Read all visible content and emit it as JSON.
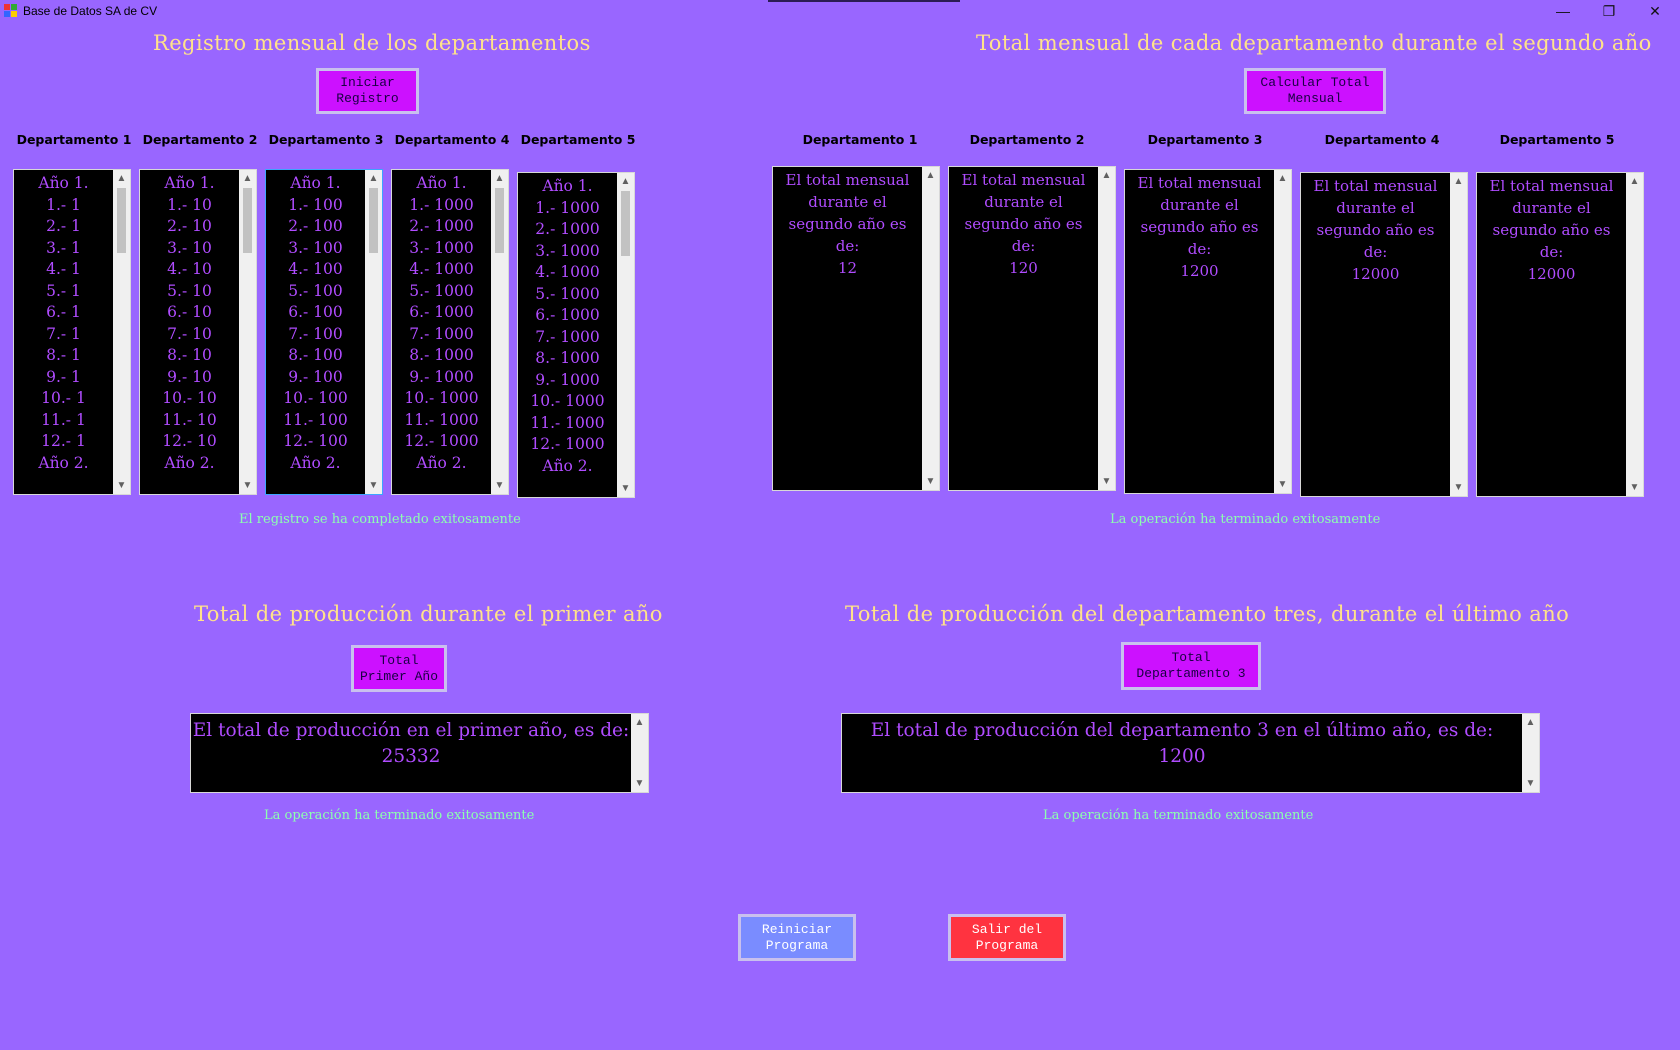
{
  "window": {
    "title": "Base de Datos SA de CV",
    "minimize_glyph": "—",
    "restore_glyph": "❐",
    "close_glyph": "✕"
  },
  "registro": {
    "title": "Registro mensual de los departamentos",
    "button": "Iniciar Registro",
    "columns": [
      "Departamento 1",
      "Departamento 2",
      "Departamento 3",
      "Departamento 4",
      "Departamento 5"
    ],
    "lists": [
      [
        "Año 1.",
        "1.- 1",
        "2.- 1",
        "3.- 1",
        "4.- 1",
        "5.- 1",
        "6.- 1",
        "7.- 1",
        "8.- 1",
        "9.- 1",
        "10.- 1",
        "11.- 1",
        "12.- 1",
        "Año 2."
      ],
      [
        "Año 1.",
        "1.- 10",
        "2.- 10",
        "3.- 10",
        "4.- 10",
        "5.- 10",
        "6.- 10",
        "7.- 10",
        "8.- 10",
        "9.- 10",
        "10.- 10",
        "11.- 10",
        "12.- 10",
        "Año 2."
      ],
      [
        "Año 1.",
        "1.- 100",
        "2.- 100",
        "3.- 100",
        "4.- 100",
        "5.- 100",
        "6.- 100",
        "7.- 100",
        "8.- 100",
        "9.- 100",
        "10.- 100",
        "11.- 100",
        "12.- 100",
        "Año 2."
      ],
      [
        "Año 1.",
        "1.- 1000",
        "2.- 1000",
        "3.- 1000",
        "4.- 1000",
        "5.- 1000",
        "6.- 1000",
        "7.- 1000",
        "8.- 1000",
        "9.- 1000",
        "10.- 1000",
        "11.- 1000",
        "12.- 1000",
        "Año 2."
      ],
      [
        "Año 1.",
        "1.- 1000",
        "2.- 1000",
        "3.- 1000",
        "4.- 1000",
        "5.- 1000",
        "6.- 1000",
        "7.- 1000",
        "8.- 1000",
        "9.- 1000",
        "10.- 1000",
        "11.- 1000",
        "12.- 1000",
        "Año 2."
      ]
    ],
    "status": "El registro se ha completado exitosamente"
  },
  "mensual": {
    "title": "Total mensual de cada departamento durante el segundo año",
    "button": "Calcular Total Mensual",
    "columns": [
      "Departamento 1",
      "Departamento 2",
      "Departamento 3",
      "Departamento 4",
      "Departamento 5"
    ],
    "boxes": [
      [
        "El total mensual",
        "durante el",
        "segundo año es",
        "de:",
        "12"
      ],
      [
        "El total mensual",
        "durante el",
        "segundo año es",
        "de:",
        "120"
      ],
      [
        "El total mensual",
        "durante el",
        "segundo año es",
        "de:",
        "1200"
      ],
      [
        "El total mensual",
        "durante el",
        "segundo año es",
        "de:",
        "12000"
      ],
      [
        "El total mensual",
        "durante el",
        "segundo año es",
        "de:",
        "12000"
      ]
    ],
    "status": "La operación ha terminado exitosamente"
  },
  "primer": {
    "title": "Total de producción durante el primer año",
    "button": "Total Primer Año",
    "lines": [
      "El total de producción en el primer año, es de:",
      "25332"
    ],
    "status": "La operación ha terminado exitosamente"
  },
  "depto3": {
    "title": "Total de producción del departamento tres, durante el último año",
    "button": "Total Departamento 3",
    "lines": [
      "El total de producción del departamento 3 en el último año, es de:",
      "1200"
    ],
    "status": "La operación ha terminado exitosamente"
  },
  "footer": {
    "restart": "Reiniciar Programa",
    "exit": "Salir del Programa"
  },
  "colors": {
    "background": "#9966ff",
    "title_text": "#ffe28a",
    "status_text": "#8dffb0",
    "button_magenta": "#cc11ff",
    "button_blue": "#7a8cff",
    "button_red": "#ff3340",
    "content_text": "#b04cff"
  },
  "icons": {
    "scroll_up": "▲",
    "scroll_down": "▼"
  }
}
